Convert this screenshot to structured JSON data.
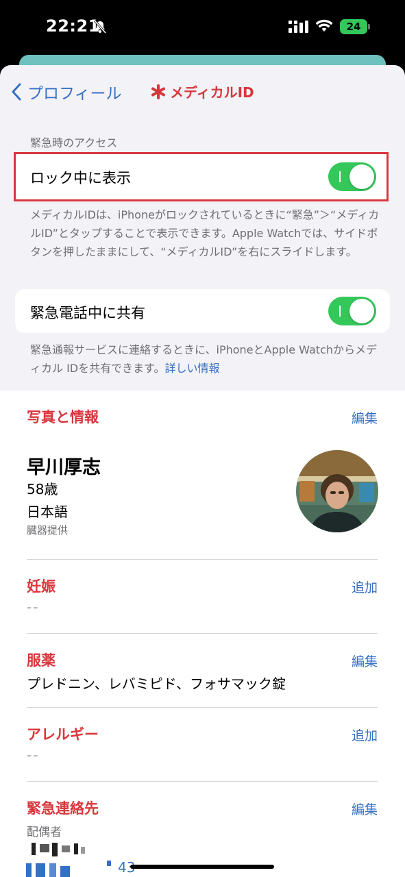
{
  "status_bar": {
    "time": "22:21",
    "battery": "24"
  },
  "nav": {
    "back_label": "プロフィール",
    "title": "メディカルID"
  },
  "emergency_access": {
    "header": "緊急時のアクセス",
    "show_when_locked": {
      "label": "ロック中に表示",
      "on": true
    },
    "show_when_locked_footer": "メディカルIDは、iPhoneがロックされているときに“緊急”＞“メディカルID”とタップすることで表示できます。Apple Watchでは、サイドボタンを押したままにして、“メディカルID”を右にスライドします。",
    "share_during_call": {
      "label": "緊急電話中に共有",
      "on": true
    },
    "share_footer": "緊急通報サービスに連絡するときに、iPhoneとApple Watchからメディカル IDを共有できます。",
    "share_footer_link": "詳しい情報"
  },
  "photo_info": {
    "title": "写真と情報",
    "action": "編集",
    "name": "早川厚志",
    "age": "58歳",
    "language": "日本語",
    "organ_donor": "臓器提供"
  },
  "pregnancy": {
    "title": "妊娠",
    "action": "追加",
    "value": "--"
  },
  "medications": {
    "title": "服薬",
    "action": "編集",
    "value": "プレドニン、レバミピド、フォサマック錠"
  },
  "allergies": {
    "title": "アレルギー",
    "action": "追加",
    "value": "--"
  },
  "emergency_contacts": {
    "title": "緊急連絡先",
    "action": "編集",
    "relation": "配偶者",
    "phone_partial": "43"
  },
  "colors": {
    "accent_red": "#d9363c",
    "link_blue": "#3670c4",
    "toggle_green": "#34c759",
    "highlight_box": "#d9363c"
  }
}
